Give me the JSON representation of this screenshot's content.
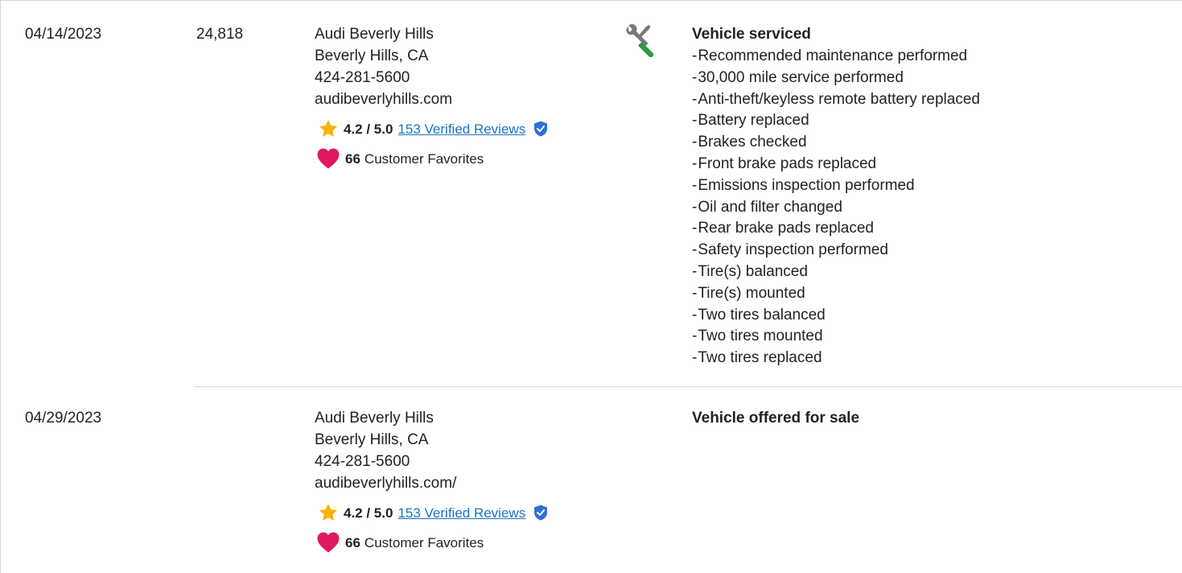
{
  "records": [
    {
      "date": "04/14/2023",
      "mileage": "24,818",
      "dealer": {
        "name": "Audi Beverly Hills",
        "location": "Beverly Hills, CA",
        "phone": "424-281-5600",
        "website": "audibeverlyhills.com",
        "rating": "4.2 / 5.0",
        "reviews": "153 Verified Reviews",
        "favorites_count": "66",
        "favorites_label": "Customer Favorites"
      },
      "icon": "wrench-screwdriver-icon",
      "title": "Vehicle serviced",
      "items": [
        "Recommended maintenance performed",
        "30,000 mile service performed",
        "Anti-theft/keyless remote battery replaced",
        "Battery replaced",
        "Brakes checked",
        "Front brake pads replaced",
        "Emissions inspection performed",
        "Oil and filter changed",
        "Rear brake pads replaced",
        "Safety inspection performed",
        "Tire(s) balanced",
        "Tire(s) mounted",
        "Two tires balanced",
        "Two tires mounted",
        "Two tires replaced"
      ]
    },
    {
      "date": "04/29/2023",
      "mileage": "",
      "dealer": {
        "name": "Audi Beverly Hills",
        "location": "Beverly Hills, CA",
        "phone": "424-281-5600",
        "website": "audibeverlyhills.com/",
        "rating": "4.2 / 5.0",
        "reviews": "153 Verified Reviews",
        "favorites_count": "66",
        "favorites_label": "Customer Favorites"
      },
      "title": "Vehicle offered for sale",
      "items": []
    }
  ],
  "colors": {
    "link": "#1a73c8",
    "star": "#f5b301",
    "heart": "#e0185f",
    "shield": "#2f6fd6",
    "wrench_gray": "#777777",
    "screwdriver_green": "#2e9a3a",
    "divider": "#d6d6d6"
  }
}
